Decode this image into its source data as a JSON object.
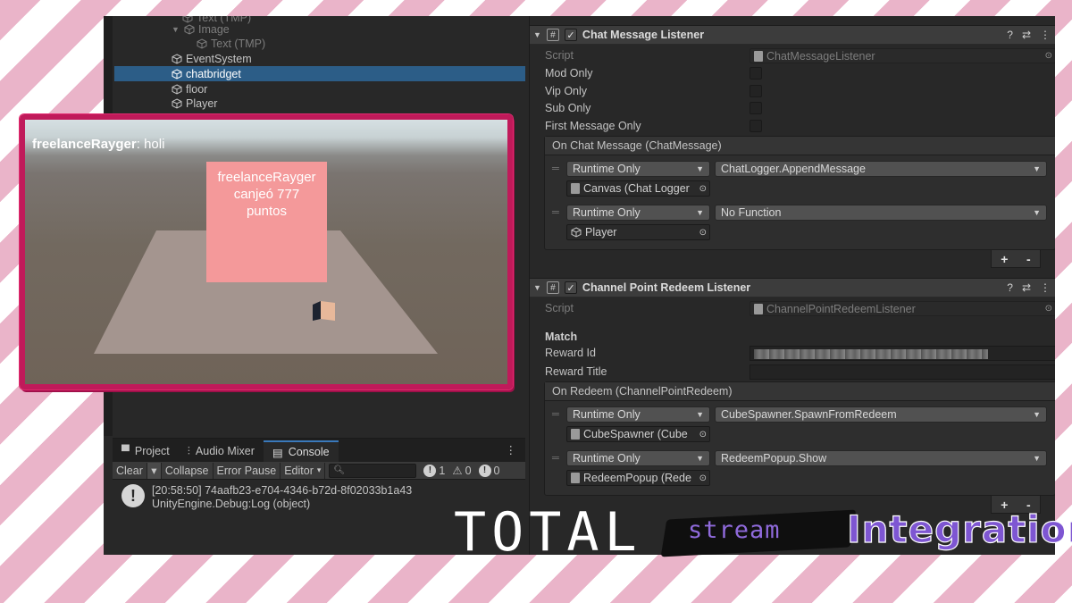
{
  "hierarchy": {
    "items": [
      {
        "label": "Text (TMP)",
        "dim": true
      },
      {
        "label": "Image",
        "dim": true
      },
      {
        "label": "Text (TMP)",
        "dim": true
      },
      {
        "label": "EventSystem"
      },
      {
        "label": "chatbridget",
        "selected": true
      },
      {
        "label": "floor"
      },
      {
        "label": "Player"
      }
    ]
  },
  "scene": {
    "chat_user": "freelanceRayger",
    "chat_message": ": holi",
    "popup_text": "freelanceRayger canjeó 777 puntos"
  },
  "console": {
    "tabs": [
      "Project",
      "Audio Mixer",
      "Console"
    ],
    "toolbar": {
      "clear": "Clear",
      "collapse": "Collapse",
      "error_pause": "Error Pause",
      "editor": "Editor"
    },
    "counts": {
      "info": "1",
      "warning": "0",
      "error": "0"
    },
    "log": {
      "line1": "[20:58:50] 74aafb23-e704-4346-b72d-8f02033b1a43",
      "line2": "UnityEngine.Debug:Log (object)"
    }
  },
  "inspector": {
    "chat_listener": {
      "title": "Chat Message Listener",
      "script_label": "Script",
      "script_value": "ChatMessageListener",
      "mod_only": "Mod Only",
      "vip_only": "Vip Only",
      "sub_only": "Sub Only",
      "first_message_only": "First Message Only",
      "event_title": "On Chat Message (ChatMessage)",
      "listeners": [
        {
          "mode": "Runtime Only",
          "function": "ChatLogger.AppendMessage",
          "target": "Canvas (Chat Logger"
        },
        {
          "mode": "Runtime Only",
          "function": "No Function",
          "target": "Player"
        }
      ]
    },
    "redeem_listener": {
      "title": "Channel Point Redeem Listener",
      "script_label": "Script",
      "script_value": "ChannelPointRedeemListener",
      "match_label": "Match",
      "reward_id": "Reward Id",
      "reward_title": "Reward Title",
      "event_title": "On Redeem (ChannelPointRedeem)",
      "listeners": [
        {
          "mode": "Runtime Only",
          "function": "CubeSpawner.SpawnFromRedeem",
          "target": "CubeSpawner (Cube"
        },
        {
          "mode": "Runtime Only",
          "function": "RedeemPopup.Show",
          "target": "RedeemPopup (Rede"
        }
      ]
    },
    "plus": "+",
    "minus": "-"
  },
  "logo": {
    "total": "TOTAL",
    "stream": "stream",
    "integration": "Integration"
  },
  "colors": {
    "selection": "#2c5d87",
    "frame": "#c01a5a",
    "popup": "#f4999a",
    "logo_purple": "#7e56d2"
  }
}
